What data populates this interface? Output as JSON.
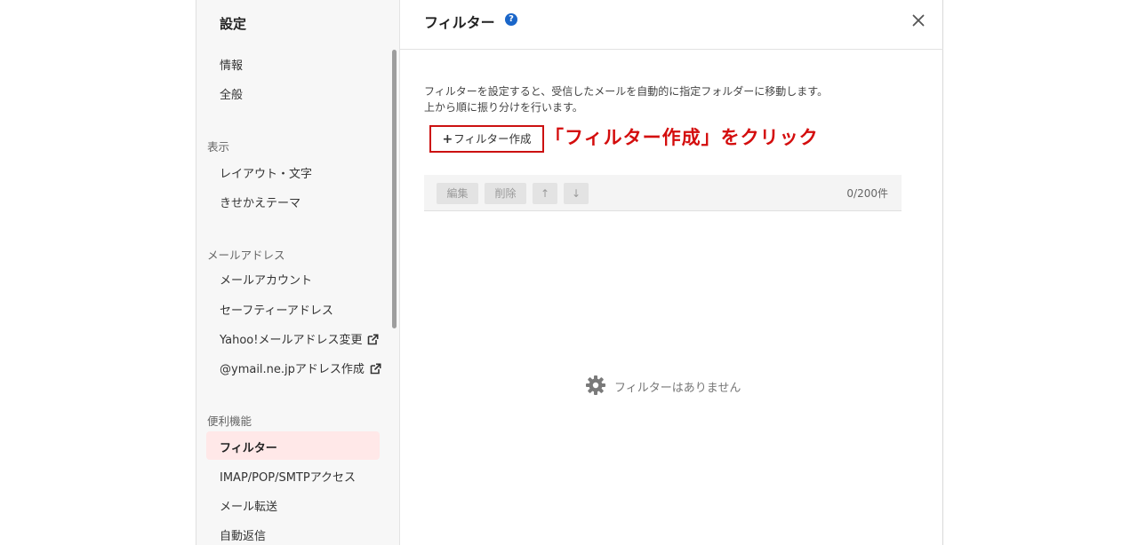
{
  "sidebar": {
    "title": "設定",
    "top_items": [
      "情報",
      "全般"
    ],
    "sections": [
      {
        "label": "表示",
        "items": [
          "レイアウト・文字",
          "きせかえテーマ"
        ]
      },
      {
        "label": "メールアドレス",
        "items": [
          "メールアカウント",
          "セーフティーアドレス",
          "Yahoo!メールアドレス変更",
          "@ymail.ne.jpアドレス作成"
        ]
      },
      {
        "label": "便利機能",
        "items": [
          "フィルター",
          "IMAP/POP/SMTPアクセス",
          "メール転送",
          "自動返信"
        ]
      }
    ],
    "active_item": "フィルター",
    "external_link_icon": "external-link-icon"
  },
  "header": {
    "title": "フィルター",
    "help_icon": "question-circle-icon",
    "help_glyph": "?",
    "close_icon": "close-icon"
  },
  "description": {
    "line1": "フィルターを設定すると、受信したメールを自動的に指定フォルダーに移動します。",
    "line2": "上から順に振り分けを行います。"
  },
  "create_button": {
    "plus": "+",
    "label": "フィルター作成"
  },
  "annotation": {
    "text": "「フィルター作成」をクリック",
    "color": "#d40d0d"
  },
  "toolbar": {
    "edit_label": "編集",
    "delete_label": "削除",
    "up_label": "↑",
    "down_label": "↓",
    "count": "0/200件"
  },
  "empty_state": {
    "icon": "gear-icon",
    "message": "フィルターはありません"
  },
  "colors": {
    "accent_red": "#cc1111",
    "active_bg": "#ffe8e8",
    "help_blue": "#1a66c9"
  }
}
